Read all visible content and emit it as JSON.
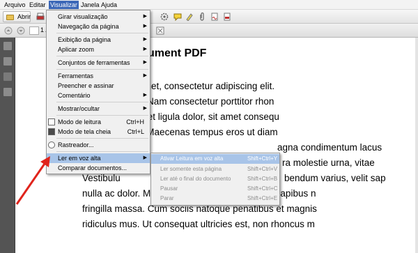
{
  "menubar": {
    "items": [
      "Arquivo",
      "Editar",
      "Visualizar",
      "Janela",
      "Ajuda"
    ]
  },
  "toolbar": {
    "open_label": "Abrir",
    "page_text": "1 /"
  },
  "document": {
    "title": "ument PDF",
    "lines": [
      "sum dolor sit amet, consectetur adipiscing elit.",
      "san non quam. Nam consectetur porttitor rhon",
      "l quis lorem. Ut et ligula dolor, sit amet consequ",
      "erdiet egestas. Maecenas tempus eros ut diam",
      "agna condimentum lacus",
      "ra molestie urna, vitae",
      "Vestibulu",
      "bendum varius, velit sap",
      "nulla ac dolor. Maecenas urna elit, tincidunt in dapibus n",
      "fringilla massa. Cum sociis natoque penatibus et magnis",
      "ridiculus mus. Ut consequat ultricies est, non rhoncus m"
    ]
  },
  "view_menu": {
    "items": {
      "rotate": "Girar visualização",
      "page_nav": "Navegação da página",
      "page_display": "Exibição da página",
      "zoom": "Aplicar zoom",
      "toolsets": "Conjuntos de ferramentas",
      "tools": "Ferramentas",
      "fill_sign": "Preencher e assinar",
      "comment": "Comentário",
      "show_hide": "Mostrar/ocultar",
      "read_mode": "Modo de leitura",
      "read_mode_key": "Ctrl+H",
      "full_screen": "Modo de tela cheia",
      "full_screen_key": "Ctrl+L",
      "tracker": "Rastreador...",
      "read_aloud": "Ler em voz alta",
      "compare": "Comparar documentos..."
    }
  },
  "read_aloud_menu": {
    "items": [
      {
        "label": "Ativar Leitura em voz alta",
        "shortcut": "Shift+Ctrl+Y"
      },
      {
        "label": "Ler somente esta página",
        "shortcut": "Shift+Ctrl+V"
      },
      {
        "label": "Ler até o final do documento",
        "shortcut": "Shift+Ctrl+B"
      },
      {
        "label": "Pausar",
        "shortcut": "Shift+Ctrl+C"
      },
      {
        "label": "Parar",
        "shortcut": "Shift+Ctrl+E"
      }
    ]
  },
  "colors": {
    "menu_active": "#3b67b7",
    "menu_highlight": "#a8c4e8",
    "arrow": "#e0231b"
  },
  "icons": [
    "folder-icon",
    "print-icon",
    "settings-icon",
    "comment-icon",
    "highlight-icon",
    "attach-icon",
    "page-up-icon",
    "page-down-icon",
    "zoom-fit-icon",
    "pages-panel-icon",
    "bookmarks-icon",
    "signature-icon",
    "tools-icon",
    "red-arrow-annotation"
  ]
}
